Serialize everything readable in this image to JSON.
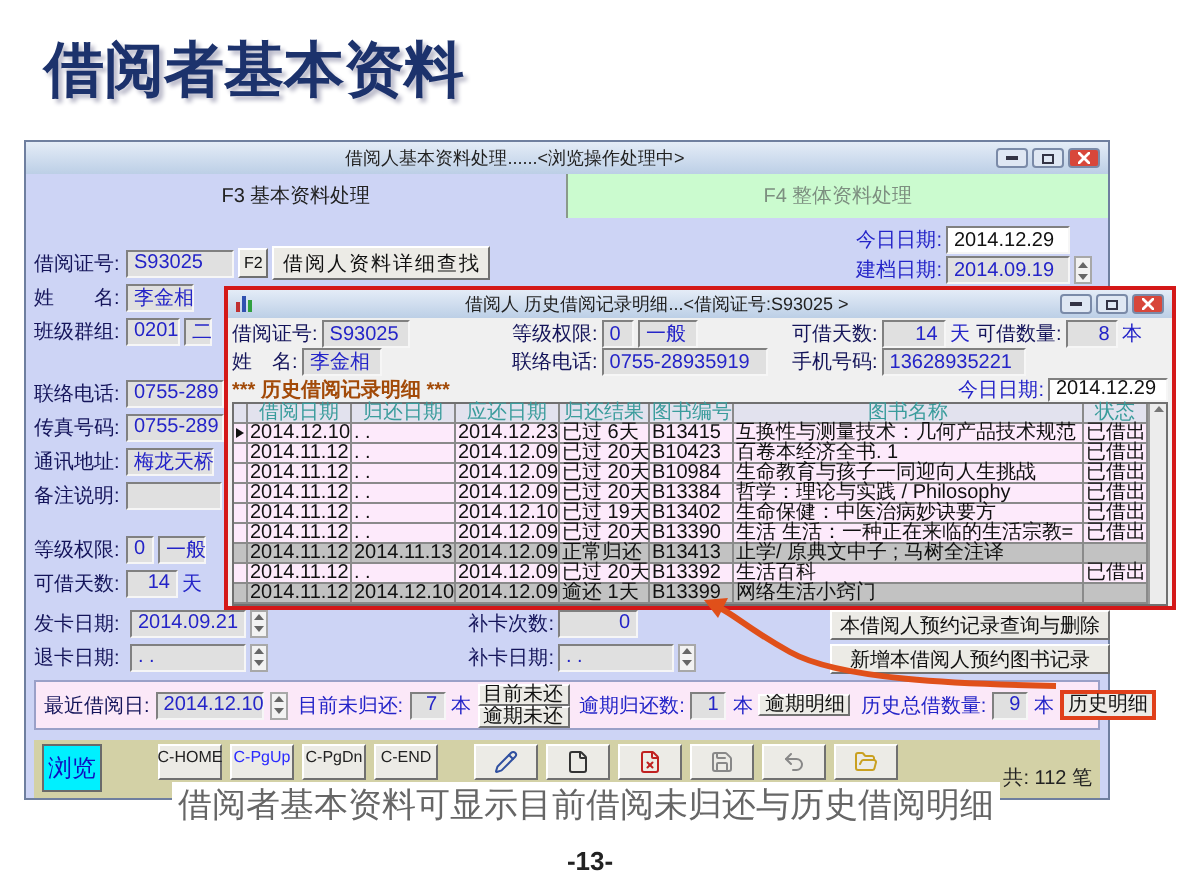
{
  "slide": {
    "title": "借阅者基本资料",
    "caption": "借阅者基本资料可显示目前借阅未归还与历史借阅明细",
    "page_number": "-13-"
  },
  "window": {
    "title": "借阅人基本资料处理......<浏览操作处理中>"
  },
  "tabs": [
    {
      "label": "F3 基本资料处理",
      "selected": true
    },
    {
      "label": "F4 整体资料处理",
      "selected": false
    }
  ],
  "form": {
    "card_no": {
      "label": "借阅证号:",
      "value": "S93025"
    },
    "f2_key": "F2",
    "find_button": "借阅人资料详细查找",
    "field_groups": [
      [
        {
          "label": "姓　　名:",
          "values": [
            "李金相"
          ]
        },
        {
          "label": "班级群组:",
          "values": [
            "0201",
            "二"
          ]
        }
      ],
      [
        {
          "label": "联络电话:",
          "values": [
            "0755-289"
          ]
        },
        {
          "label": "传真号码:",
          "values": [
            "0755-289"
          ]
        },
        {
          "label": "通讯地址:",
          "values": [
            "梅龙天桥"
          ]
        },
        {
          "label": "备注说明:"
        }
      ],
      [
        {
          "label": "等级权限:",
          "values": [
            "0",
            "一般"
          ]
        },
        {
          "label": "可借天数:",
          "values": [
            "14"
          ],
          "unit": "天"
        }
      ]
    ],
    "dates": [
      {
        "label": "今日日期:",
        "value": "2014.12.29",
        "kind": "plain"
      },
      {
        "label": "建档日期:",
        "value": "2014.09.19",
        "kind": "spin"
      }
    ],
    "card_rows": [
      [
        {
          "label": "发卡日期:",
          "value": "2014.09.21",
          "kind": "spin"
        },
        {
          "label": "补卡次数:",
          "value": "0",
          "kind": "plain"
        }
      ],
      [
        {
          "label": "退卡日期:",
          "value": ". .",
          "kind": "spin"
        },
        {
          "label": "补卡日期:",
          "value": ". .",
          "kind": "spin"
        }
      ]
    ],
    "reservation_buttons": [
      "本借阅人预约记录查询与删除",
      "新增本借阅人预约图书记录"
    ]
  },
  "summary": {
    "last_borrow": {
      "label": "最近借阅日:",
      "value": "2014.12.10"
    },
    "items": [
      {
        "label": "目前未归还:",
        "value": "7",
        "unit": "本",
        "buttons": [
          {
            "label": "目前未还",
            "highlighted": false
          },
          {
            "label": "逾期未还",
            "highlighted": false
          }
        ]
      },
      {
        "label": "逾期归还数:",
        "value": "1",
        "unit": "本",
        "buttons": [
          {
            "label": "逾期明细",
            "highlighted": false
          }
        ]
      },
      {
        "label": "历史总借数量:",
        "value": "9",
        "unit": "本",
        "buttons": [
          {
            "label": "历史明细",
            "highlighted": true
          }
        ]
      }
    ]
  },
  "toolbar": {
    "mode": "浏览",
    "nav_buttons": [
      {
        "label": "C-HOME",
        "selected": false
      },
      {
        "label": "C-PgUp",
        "selected": true
      },
      {
        "label": "C-PgDn",
        "selected": false
      },
      {
        "label": "C-END",
        "selected": false
      }
    ],
    "record_count": "共: 112 笔"
  },
  "dialog": {
    "title": "借阅人 历史借阅记录明细...<借阅证号:S93025 >",
    "field_rows": [
      [
        {
          "label": "借阅证号:",
          "values": [
            "S93025"
          ]
        },
        {
          "label": "等级权限:",
          "values": [
            "0",
            "一般"
          ]
        },
        {
          "label": "可借天数:",
          "values": [
            "14"
          ],
          "unit": "天"
        },
        {
          "label": "可借数量:",
          "values": [
            "8"
          ],
          "unit": "本"
        }
      ],
      [
        {
          "label": "姓　名:",
          "values": [
            "李金相"
          ]
        },
        {
          "label": "联络电话:",
          "values": [
            "0755-28935919"
          ]
        },
        {
          "label": "手机号码:",
          "values": [
            "13628935221"
          ]
        }
      ]
    ],
    "heading": "*** 历史借阅记录明细 ***",
    "today": {
      "label": "今日日期:",
      "value": "2014.12.29"
    },
    "columns": [
      "借阅日期",
      "归还日期",
      "应还日期",
      "归还结果",
      "图书编号",
      "图书名称",
      "状态"
    ],
    "rows": [
      {
        "selected": true,
        "returned": false,
        "cells": [
          "2014.12.10",
          ". .",
          "2014.12.23",
          "已过 6天",
          "B13415",
          "互换性与测量技术：几何产品技术规范",
          "已借出"
        ]
      },
      {
        "selected": false,
        "returned": false,
        "cells": [
          "2014.11.12",
          ". .",
          "2014.12.09",
          "已过 20天",
          "B10423",
          "百卷本经济全书. 1",
          "已借出"
        ]
      },
      {
        "selected": false,
        "returned": false,
        "cells": [
          "2014.11.12",
          ". .",
          "2014.12.09",
          "已过 20天",
          "B10984",
          "生命教育与孩子一同迎向人生挑战",
          "已借出"
        ]
      },
      {
        "selected": false,
        "returned": false,
        "cells": [
          "2014.11.12",
          ". .",
          "2014.12.09",
          "已过 20天",
          "B13384",
          "哲学：理论与实践 / Philosophy",
          "已借出"
        ]
      },
      {
        "selected": false,
        "returned": false,
        "cells": [
          "2014.11.12",
          ". .",
          "2014.12.10",
          "已过 19天",
          "B13402",
          "生命保健：中医治病妙诀要方",
          "已借出"
        ]
      },
      {
        "selected": false,
        "returned": false,
        "cells": [
          "2014.11.12",
          ". .",
          "2014.12.09",
          "已过 20天",
          "B13390",
          "生活 生活：一种正在来临的生活宗教=",
          "已借出"
        ]
      },
      {
        "selected": false,
        "returned": true,
        "cells": [
          "2014.11.12",
          "2014.11.13",
          "2014.12.09",
          "正常归还",
          "B13413",
          "止学/ 原典文中子 ; 马树全注译"
        ]
      },
      {
        "selected": false,
        "returned": false,
        "cells": [
          "2014.11.12",
          ". .",
          "2014.12.09",
          "已过 20天",
          "B13392",
          "生活百科",
          "已借出"
        ]
      },
      {
        "selected": false,
        "returned": true,
        "cells": [
          "2014.11.12",
          "2014.12.10",
          "2014.12.09",
          "逾还 1天",
          "B13399",
          "网络生活小窍门"
        ]
      }
    ]
  }
}
